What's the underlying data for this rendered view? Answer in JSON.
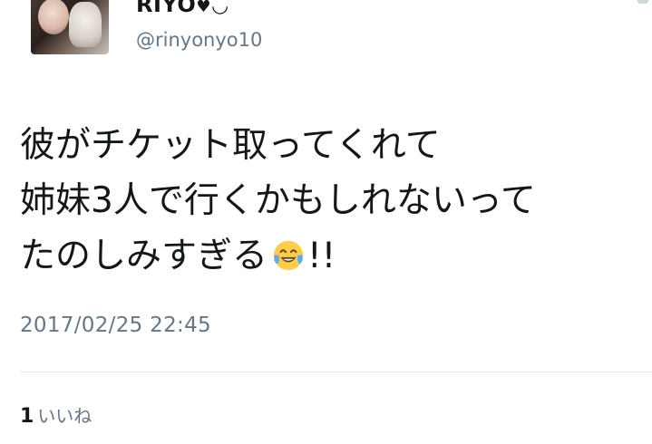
{
  "user": {
    "display_name": "RIYO",
    "display_name_heart": "♥",
    "display_name_smile": "◡̈",
    "handle": "@rinyonyo10"
  },
  "tweet": {
    "line1": "彼がチケット取ってくれて",
    "line2": "姉妹3人で行くかもしれないって",
    "line3_text": "たのしみすぎる",
    "line3_emoji": "face-with-tears-of-joy-emoji",
    "line3_suffix": "!!",
    "timestamp": "2017/02/25 22:45"
  },
  "stats": {
    "likes_count": "1",
    "likes_label": "いいね"
  },
  "colors": {
    "text_primary": "#14171a",
    "text_secondary": "#657786",
    "divider": "#e1e8ed"
  }
}
